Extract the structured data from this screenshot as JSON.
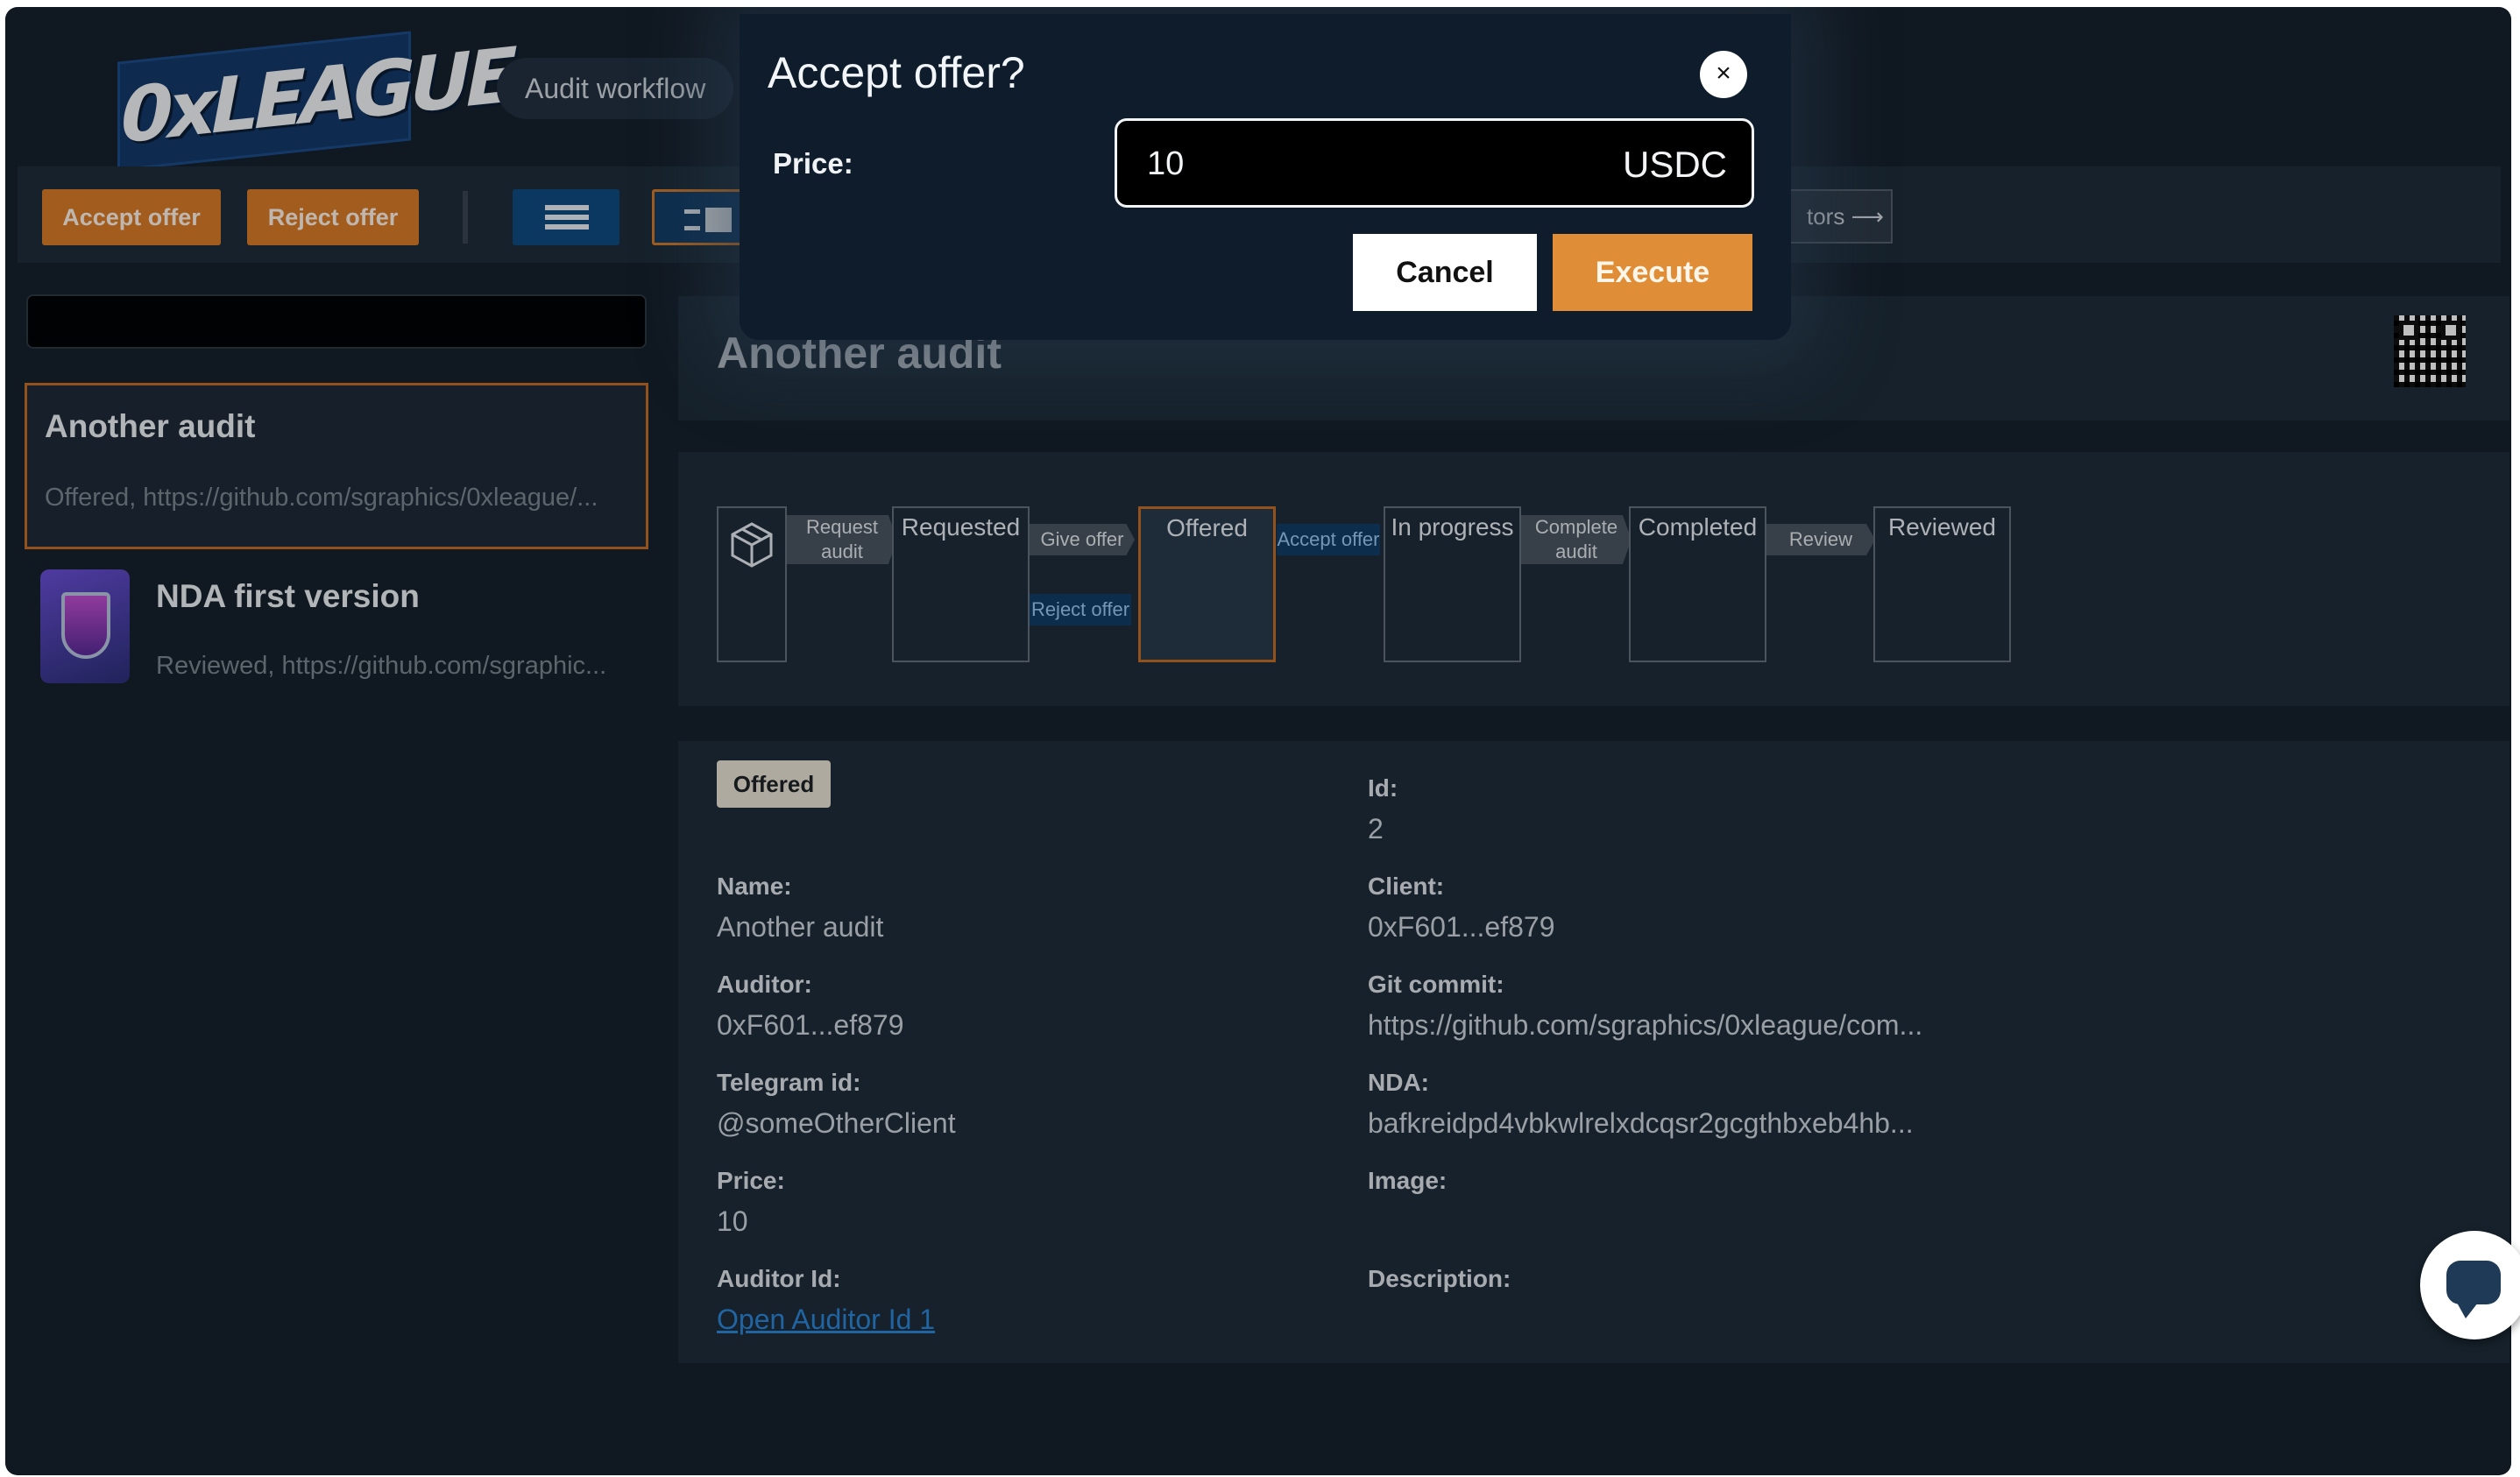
{
  "app": {
    "logo_text": "0xLEAGUE"
  },
  "header": {
    "pill_label": "Audit workflow"
  },
  "toolbar": {
    "accept_label": "Accept offer",
    "reject_label": "Reject offer",
    "partial_link": "tors ⟶"
  },
  "sidebar": {
    "items": [
      {
        "title": "Another audit",
        "subtitle": "Offered, https://github.com/sgraphics/0xleague/..."
      },
      {
        "title": "NDA first version",
        "subtitle": "Reviewed, https://github.com/sgraphic..."
      }
    ]
  },
  "detail": {
    "title": "Another audit",
    "workflow": {
      "states": [
        "Requested",
        "Offered",
        "In progress",
        "Completed",
        "Reviewed"
      ],
      "active_state": "Offered",
      "transitions": {
        "request": [
          "Request",
          "audit"
        ],
        "give": "Give offer",
        "reject": "Reject offer",
        "accept": "Accept offer",
        "complete": [
          "Complete",
          "audit"
        ],
        "review": "Review"
      }
    },
    "status_badge": "Offered",
    "fields": {
      "id": {
        "label": "Id:",
        "value": "2"
      },
      "name": {
        "label": "Name:",
        "value": "Another audit"
      },
      "client": {
        "label": "Client:",
        "value": "0xF601...ef879"
      },
      "auditor": {
        "label": "Auditor:",
        "value": "0xF601...ef879"
      },
      "git": {
        "label": "Git commit:",
        "value": "https://github.com/sgraphics/0xleague/com..."
      },
      "telegram": {
        "label": "Telegram id:",
        "value": "@someOtherClient"
      },
      "nda": {
        "label": "NDA:",
        "value": "bafkreidpd4vbkwlrelxdcqsr2gcgthbxeb4hb..."
      },
      "price": {
        "label": "Price:",
        "value": "10"
      },
      "image": {
        "label": "Image:",
        "value": ""
      },
      "auditor_id": {
        "label": "Auditor Id:",
        "value": "Open Auditor Id 1"
      },
      "description": {
        "label": "Description:",
        "value": ""
      }
    }
  },
  "modal": {
    "title": "Accept offer?",
    "close_glyph": "×",
    "price_label": "Price:",
    "price_value": "10",
    "currency": "USDC",
    "cancel_label": "Cancel",
    "execute_label": "Execute"
  },
  "colors": {
    "accent": "#d97d29",
    "background": "#16212c",
    "panel": "#1e2c3a",
    "link": "#2d86d8"
  }
}
